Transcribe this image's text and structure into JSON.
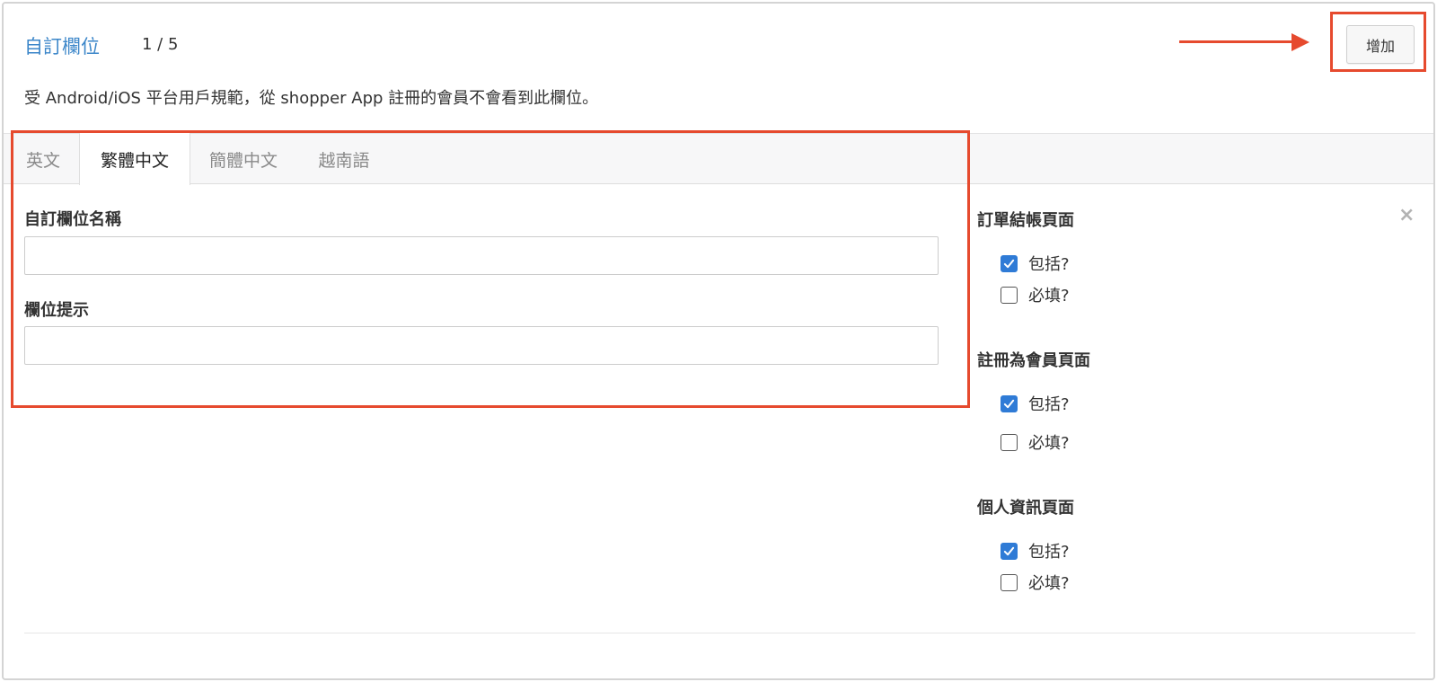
{
  "panel": {
    "title": "自訂欄位",
    "count": "1 / 5",
    "notice": "受 Android/iOS 平台用戶規範，從 shopper App 註冊的會員不會看到此欄位。",
    "add_button": "增加"
  },
  "tabs": [
    {
      "label": "英文",
      "active": false
    },
    {
      "label": "繁體中文",
      "active": true
    },
    {
      "label": "簡體中文",
      "active": false
    },
    {
      "label": "越南語",
      "active": false
    }
  ],
  "form": {
    "name_label": "自訂欄位名稱",
    "name_value": "",
    "hint_label": "欄位提示",
    "hint_value": ""
  },
  "sections": [
    {
      "title": "訂單結帳頁面",
      "include_label": "包括?",
      "include_checked": true,
      "required_label": "必填?",
      "required_checked": false
    },
    {
      "title": "註冊為會員頁面",
      "include_label": "包括?",
      "include_checked": true,
      "required_label": "必填?",
      "required_checked": false
    },
    {
      "title": "個人資訊頁面",
      "include_label": "包括?",
      "include_checked": true,
      "required_label": "必填?",
      "required_checked": false
    }
  ],
  "close_icon": "close-icon",
  "colors": {
    "accent": "#3b86c9",
    "highlight": "#e64a2e",
    "checkbox_checked": "#2f7bd6"
  }
}
